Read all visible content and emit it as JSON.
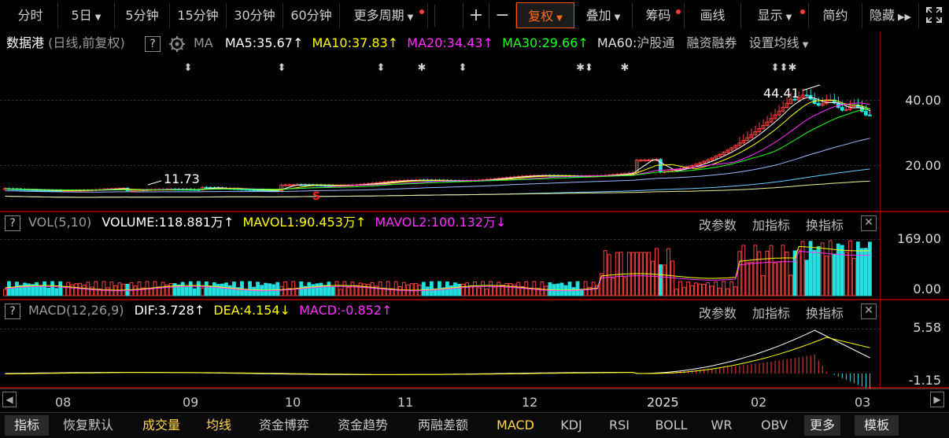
{
  "toolbar": {
    "periods": [
      "分时",
      "5日",
      "5分钟",
      "15分钟",
      "30分钟",
      "60分钟",
      "更多周期"
    ],
    "plus": "+",
    "minus": "−",
    "fuquan": "复权",
    "diejia": "叠加",
    "chouma": "筹码",
    "huaxian": "画线",
    "xianshi": "显示",
    "jianyue": "简约",
    "yincang": "隐藏",
    "expand_icon": "fullscreen-icon"
  },
  "main_pane": {
    "name": "数据港",
    "mode": "(日线,前复权)",
    "help": "?",
    "ma_label": "MA",
    "ma5": "MA5:35.67",
    "ma10": "MA10:37.83",
    "ma20": "MA20:34.43",
    "ma30": "MA30:29.66",
    "ma60": "MA60:",
    "hugutong": "沪股通",
    "rongzi": "融资融券",
    "shezhi": "设置均线",
    "arrow_up": "↑",
    "high_label": "44.41",
    "low_label": "11.73",
    "s_marker": "S",
    "y_ticks": [
      "40.00",
      "20.00"
    ],
    "colors": {
      "ma5": "#ffffff",
      "ma10": "#ffff00",
      "ma20": "#ff33ff",
      "ma30": "#00ff00",
      "up": "#ff4040",
      "down": "#22e0e0"
    }
  },
  "vol_pane": {
    "help": "?",
    "title": "VOL(5,10)",
    "volume": "VOLUME:118.881万",
    "mavol1": "MAVOL1:90.453万",
    "mavol2": "MAVOL2:100.132万",
    "arrow_up": "↑",
    "arrow_down": "↓",
    "gaicanshu": "改参数",
    "jiazhibiao": "加指标",
    "huanzhibiao": "换指标",
    "y_ticks": [
      "169.00",
      "0.00"
    ]
  },
  "macd_pane": {
    "help": "?",
    "title": "MACD(12,26,9)",
    "dif": "DIF:3.728",
    "dea": "DEA:4.154",
    "macd": "MACD:-0.852",
    "arrow_up": "↑",
    "arrow_down": "↓",
    "gaicanshu": "改参数",
    "jiazhibiao": "加指标",
    "huanzhibiao": "换指标",
    "y_ticks": [
      "5.58",
      "-1.15"
    ]
  },
  "x_axis": [
    "08",
    "09",
    "10",
    "11",
    "12",
    "2025",
    "02",
    "03"
  ],
  "bottom_tabs": [
    "指标",
    "恢复默认",
    "成交量",
    "均线",
    "资金博弈",
    "资金趋势",
    "两融差额",
    "MACD",
    "KDJ",
    "RSI",
    "BOLL",
    "WR",
    "OBV",
    "更多",
    "模板"
  ]
}
